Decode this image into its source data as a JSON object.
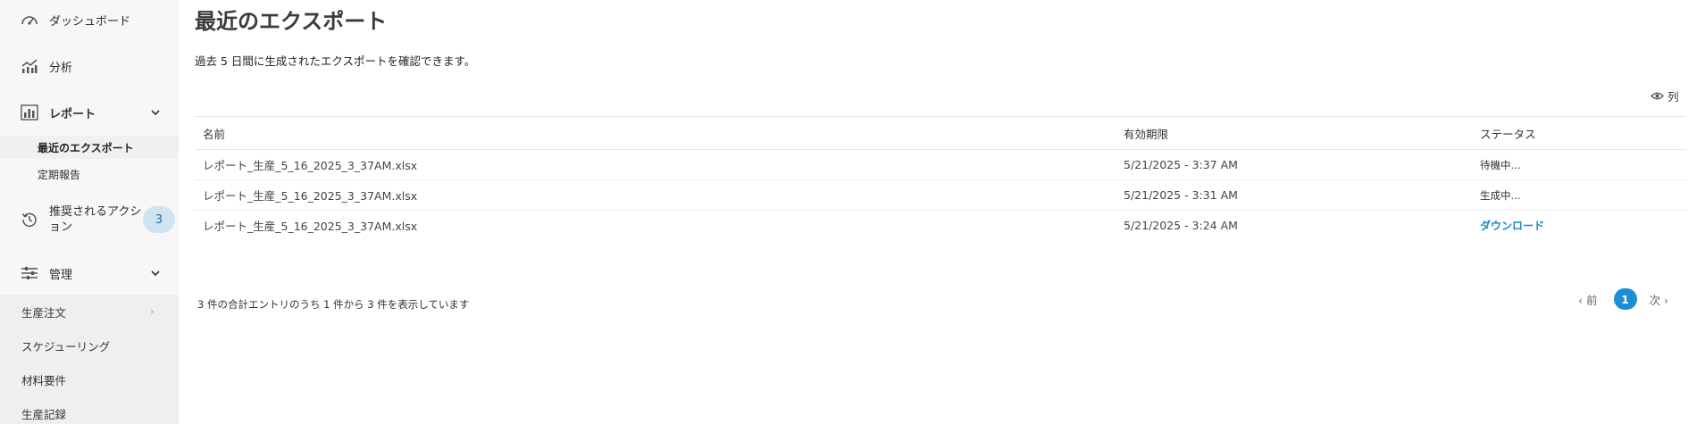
{
  "sidebar": {
    "dashboard": "ダッシュボード",
    "analytics": "分析",
    "reports": "レポート",
    "reports_sub": [
      "最近のエクスポート",
      "定期報告"
    ],
    "recommended": "推奨されるアクション",
    "recommended_count": "3",
    "admin": "管理",
    "admin_sub": [
      "生産注文",
      "スケジューリング",
      "材料要件",
      "生産記録"
    ]
  },
  "main": {
    "title": "最近のエクスポート",
    "description": "過去 5 日間に生成されたエクスポートを確認できます。",
    "columns_label": "列",
    "table": {
      "headers": [
        "名前",
        "有効期限",
        "ステータス"
      ],
      "rows": [
        {
          "name": "レポート_生産_5_16_2025_3_37AM.xlsx",
          "expires": "5/21/2025 - 3:37 AM",
          "status": "待機中..."
        },
        {
          "name": "レポート_生産_5_16_2025_3_37AM.xlsx",
          "expires": "5/21/2025 - 3:31 AM",
          "status": "生成中..."
        },
        {
          "name": "レポート_生産_5_16_2025_3_37AM.xlsx",
          "expires": "5/21/2025 - 3:24 AM",
          "status": "ダウンロード"
        }
      ]
    },
    "summary": "3 件の合計エントリのうち 1 件から 3 件を表示しています",
    "pagination": {
      "prev": "前",
      "current": "1",
      "next": "次"
    }
  },
  "colors": {
    "accent": "#1a8fd6",
    "link": "#1a86c8",
    "badge_bg": "#cfe3f1"
  }
}
